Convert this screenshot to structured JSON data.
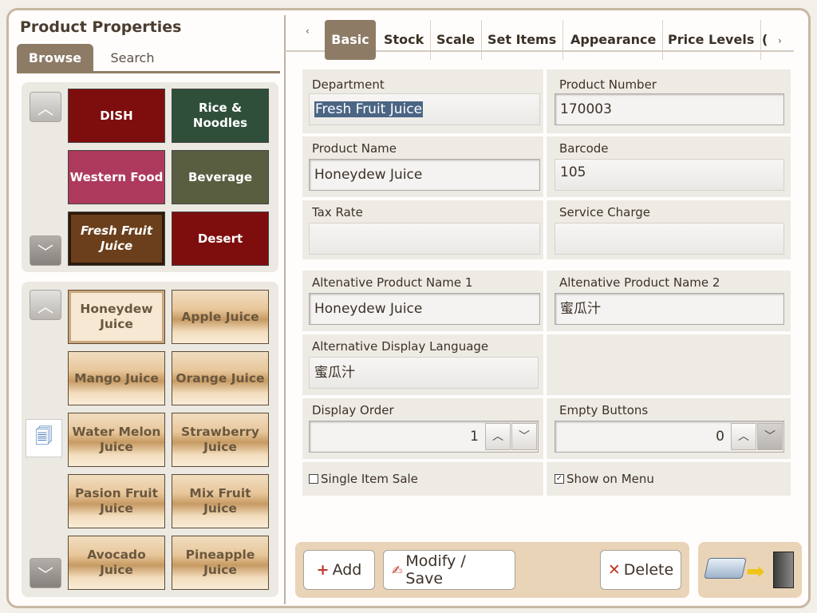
{
  "left_panel": {
    "title": "Product Properties",
    "tabs": [
      {
        "label": "Browse",
        "active": true
      },
      {
        "label": "Search",
        "active": false
      }
    ],
    "categories": [
      {
        "label": "DISH",
        "color": "#7e0d0d"
      },
      {
        "label": "Rice & Noodles",
        "color": "#2f4f3a"
      },
      {
        "label": "Western Food",
        "color": "#ad3a5d"
      },
      {
        "label": "Beverage",
        "color": "#5a5e40"
      },
      {
        "label": "Fresh Fruit Juice",
        "color": "#6b3f1b",
        "selected": true
      },
      {
        "label": "Desert",
        "color": "#7e0d0d"
      }
    ],
    "products": [
      {
        "label": "Honeydew Juice",
        "selected": true
      },
      {
        "label": "Apple Juice"
      },
      {
        "label": "Mango Juice"
      },
      {
        "label": "Orange Juice"
      },
      {
        "label": "Water Melon Juice"
      },
      {
        "label": "Strawberry Juice"
      },
      {
        "label": "Pasion Fruit Juice"
      },
      {
        "label": "Mix Fruit Juice"
      },
      {
        "label": "Avocado Juice"
      },
      {
        "label": "Pineapple Juice"
      }
    ]
  },
  "tabs": [
    {
      "label": "Basic",
      "active": true
    },
    {
      "label": "Stock"
    },
    {
      "label": "Scale"
    },
    {
      "label": "Set Items"
    },
    {
      "label": "Appearance"
    },
    {
      "label": "Price Levels"
    },
    {
      "label": "("
    }
  ],
  "form": {
    "department": {
      "label": "Department",
      "value": "Fresh Fruit Juice"
    },
    "product_number": {
      "label": "Product Number",
      "value": "170003"
    },
    "product_name": {
      "label": "Product Name",
      "value": "Honeydew Juice"
    },
    "barcode": {
      "label": "Barcode",
      "value": "105"
    },
    "tax_rate": {
      "label": "Tax Rate",
      "value": ""
    },
    "service_charge": {
      "label": "Service Charge",
      "value": ""
    },
    "alt_name_1": {
      "label": "Altenative Product Name 1",
      "value": "Honeydew Juice"
    },
    "alt_name_2": {
      "label": "Altenative Product Name 2",
      "value": "蜜瓜汁"
    },
    "alt_display_language": {
      "label": "Alternative Display Language",
      "value": "蜜瓜汁"
    },
    "display_order": {
      "label": "Display Order",
      "value": "1"
    },
    "empty_buttons": {
      "label": "Empty Buttons",
      "value": "0"
    },
    "single_item_sale": {
      "label": "Single Item Sale",
      "checked": false
    },
    "show_on_menu": {
      "label": "Show on Menu",
      "checked": true
    }
  },
  "actions": {
    "add": "Add",
    "modify_save": "Modify / Save",
    "delete": "Delete"
  }
}
